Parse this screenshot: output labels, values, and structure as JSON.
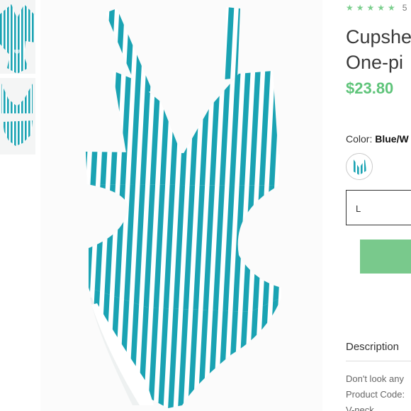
{
  "thumbnails": [
    {
      "name": "one-piece-front-thumbnail"
    },
    {
      "name": "bikini-set-thumbnail"
    }
  ],
  "product_image": {
    "icon": "striped-one-piece-swimsuit-image"
  },
  "rating": {
    "stars": "★★★★★",
    "value": 5,
    "count_text": "5"
  },
  "product": {
    "title_line1": "Cupshe",
    "title_line2": "One-pi",
    "price": "$23.80"
  },
  "color": {
    "label": "Color:",
    "value": "Blue/W"
  },
  "size": {
    "selected": "L"
  },
  "add_to_cart": {
    "label": ""
  },
  "description": {
    "heading": "Description",
    "lines": [
      "Don't look any",
      "Product Code:",
      "V-neck"
    ]
  },
  "colors": {
    "accent": "#79c98c",
    "price": "#5fc47a",
    "stripe": "#1aa3b3"
  }
}
